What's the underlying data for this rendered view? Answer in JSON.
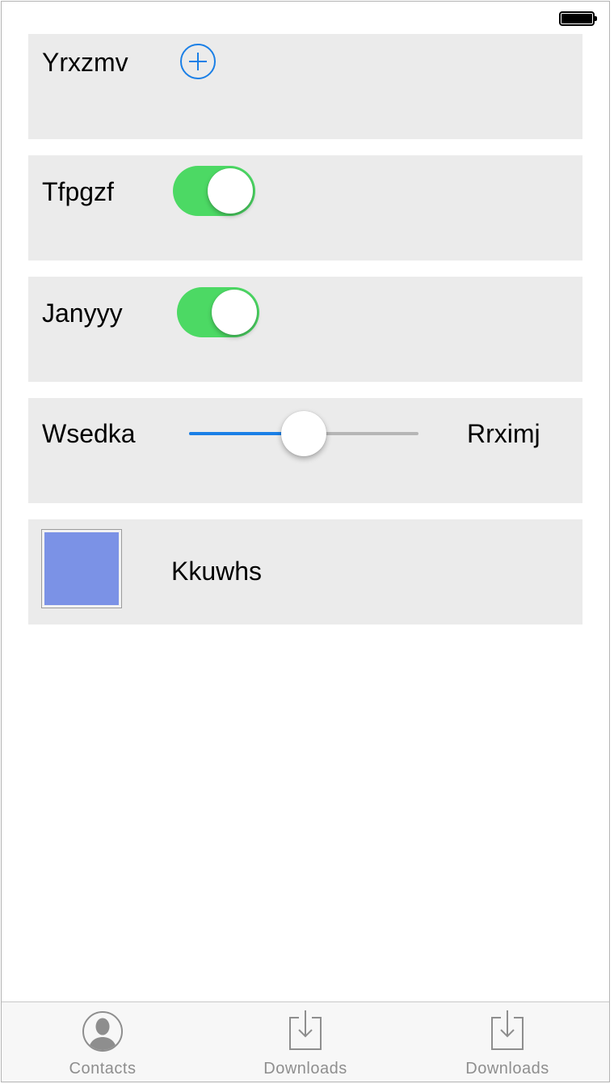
{
  "colors": {
    "accent": "#1a7fe6",
    "toggle_on": "#4cd964",
    "row_background": "#ebebeb",
    "swatch": "#7b92e6"
  },
  "status_bar": {
    "battery_icon": "battery-full-icon"
  },
  "rows": {
    "row1": {
      "label": "Yrxzmv",
      "control": "add-icon"
    },
    "row2": {
      "label": "Tfpgzf",
      "toggle_on": true
    },
    "row3": {
      "label": "Janyyy",
      "toggle_on": true
    },
    "row4": {
      "label": "Wsedka",
      "value_label": "Rrximj",
      "slider_value": 0.5
    },
    "row5": {
      "label": "Kkuwhs",
      "swatch_color": "#7b92e6"
    }
  },
  "tabbar": {
    "tabs": [
      {
        "label": "Contacts",
        "icon": "contact-person-icon"
      },
      {
        "label": "Downloads",
        "icon": "download-tray-icon"
      },
      {
        "label": "Downloads",
        "icon": "download-tray-icon"
      }
    ]
  }
}
